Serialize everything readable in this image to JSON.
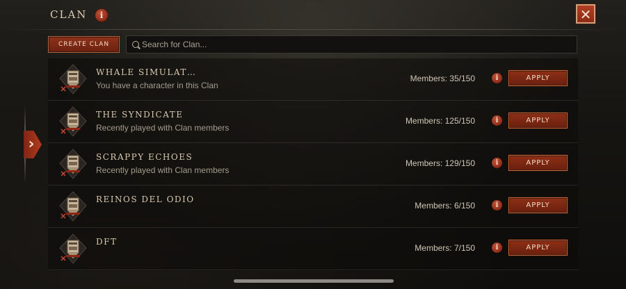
{
  "header": {
    "title": "CLAN",
    "info_icon": "info-icon",
    "close_icon": "close-icon",
    "close_glyph": "✕",
    "info_glyph": "i"
  },
  "toolbar": {
    "create_label": "CREATE CLAN",
    "search_placeholder": "Search for Clan...",
    "search_value": ""
  },
  "side_tab": {
    "icon": "chevron-right-icon",
    "glyph": "›"
  },
  "clans": [
    {
      "name": "WHALE SIMULAT…",
      "status": "You have a character in this Clan",
      "members": "Members: 35/150",
      "apply_label": "APPLY"
    },
    {
      "name": "THE SYNDICATE",
      "status": "Recently played with Clan members",
      "members": "Members: 125/150",
      "apply_label": "APPLY"
    },
    {
      "name": "SCRAPPY ECHOES",
      "status": "Recently played with Clan members",
      "members": "Members: 129/150",
      "apply_label": "APPLY"
    },
    {
      "name": "REINOS DEL ODIO",
      "status": "",
      "members": "Members: 6/150",
      "apply_label": "APPLY"
    },
    {
      "name": "DFT",
      "status": "",
      "members": "Members: 7/150",
      "apply_label": "APPLY"
    }
  ],
  "colors": {
    "accent_red": "#8e2f17",
    "text_gold": "#d8c9ae",
    "text_muted": "#a49c8d"
  }
}
